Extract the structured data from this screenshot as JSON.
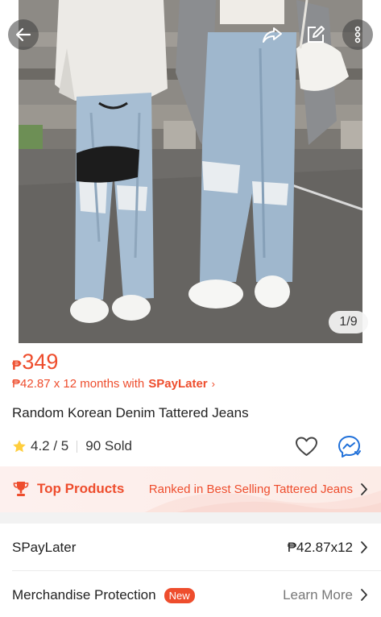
{
  "gallery": {
    "counter": "1/9",
    "alt": "Random Korean Denim Tattered Jeans"
  },
  "top_bar": {
    "back_icon": "arrow-left-icon",
    "share_icon": "share-icon",
    "edit_icon": "edit-icon",
    "more_icon": "more-vertical-icon"
  },
  "product": {
    "currency": "₱",
    "price": "349",
    "installment_text": "₱42.87 x 12 months with",
    "installment_brand": "SPayLater",
    "installment_chevron": "›",
    "title": "Random Korean Denim Tattered Jeans",
    "rating": "4.2 / 5",
    "sold": "90 Sold"
  },
  "actions": {
    "like_icon": "heart-icon",
    "chat_icon": "messenger-icon"
  },
  "top_products": {
    "label": "Top Products",
    "ranked_text": "Ranked in Best Selling Tattered Jeans"
  },
  "rows": {
    "spaylater_label": "SPayLater",
    "spaylater_value": "₱42.87x12",
    "protection_label": "Merchandise Protection",
    "protection_badge": "New",
    "protection_action": "Learn More"
  },
  "colors": {
    "accent": "#ee4d2d",
    "banner_bg": "#fdf0ee",
    "star": "#ffce3d",
    "chat": "#1e6fd9"
  }
}
